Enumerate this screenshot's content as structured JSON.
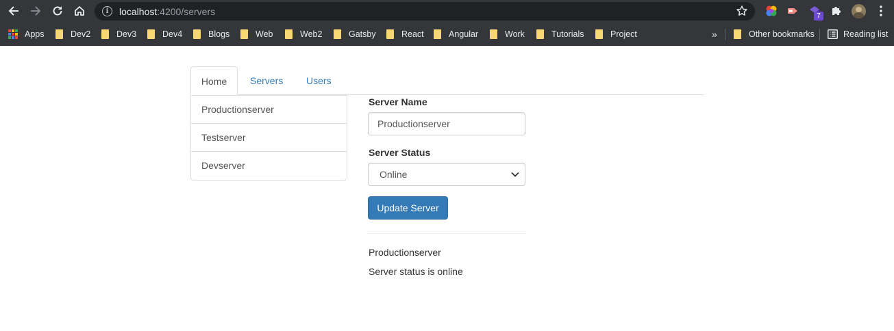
{
  "browser": {
    "url_host": "localhost",
    "url_path": ":4200/servers",
    "extension_badge": "7",
    "bookmarks": {
      "apps_label": "Apps",
      "items": [
        "Dev2",
        "Dev3",
        "Dev4",
        "Blogs",
        "Web",
        "Web2",
        "Gatsby",
        "React",
        "Angular",
        "Work",
        "Tutorials",
        "Project"
      ],
      "overflow": "»",
      "other_bookmarks": "Other bookmarks",
      "reading_list": "Reading list"
    }
  },
  "page": {
    "tabs": [
      {
        "label": "Home",
        "active": true
      },
      {
        "label": "Servers",
        "active": false
      },
      {
        "label": "Users",
        "active": false
      }
    ],
    "servers": [
      "Productionserver",
      "Testserver",
      "Devserver"
    ],
    "form": {
      "server_name_label": "Server Name",
      "server_name_value": "Productionserver",
      "server_status_label": "Server Status",
      "server_status_value": "Online",
      "update_button": "Update Server"
    },
    "output": {
      "name": "Productionserver",
      "status_text": "Server status is online"
    }
  },
  "colors": {
    "chrome_bg": "#35363a",
    "omnibox_bg": "#202124",
    "link": "#337ab7",
    "primary_button": "#337ab7",
    "folder": "#f7d774"
  }
}
